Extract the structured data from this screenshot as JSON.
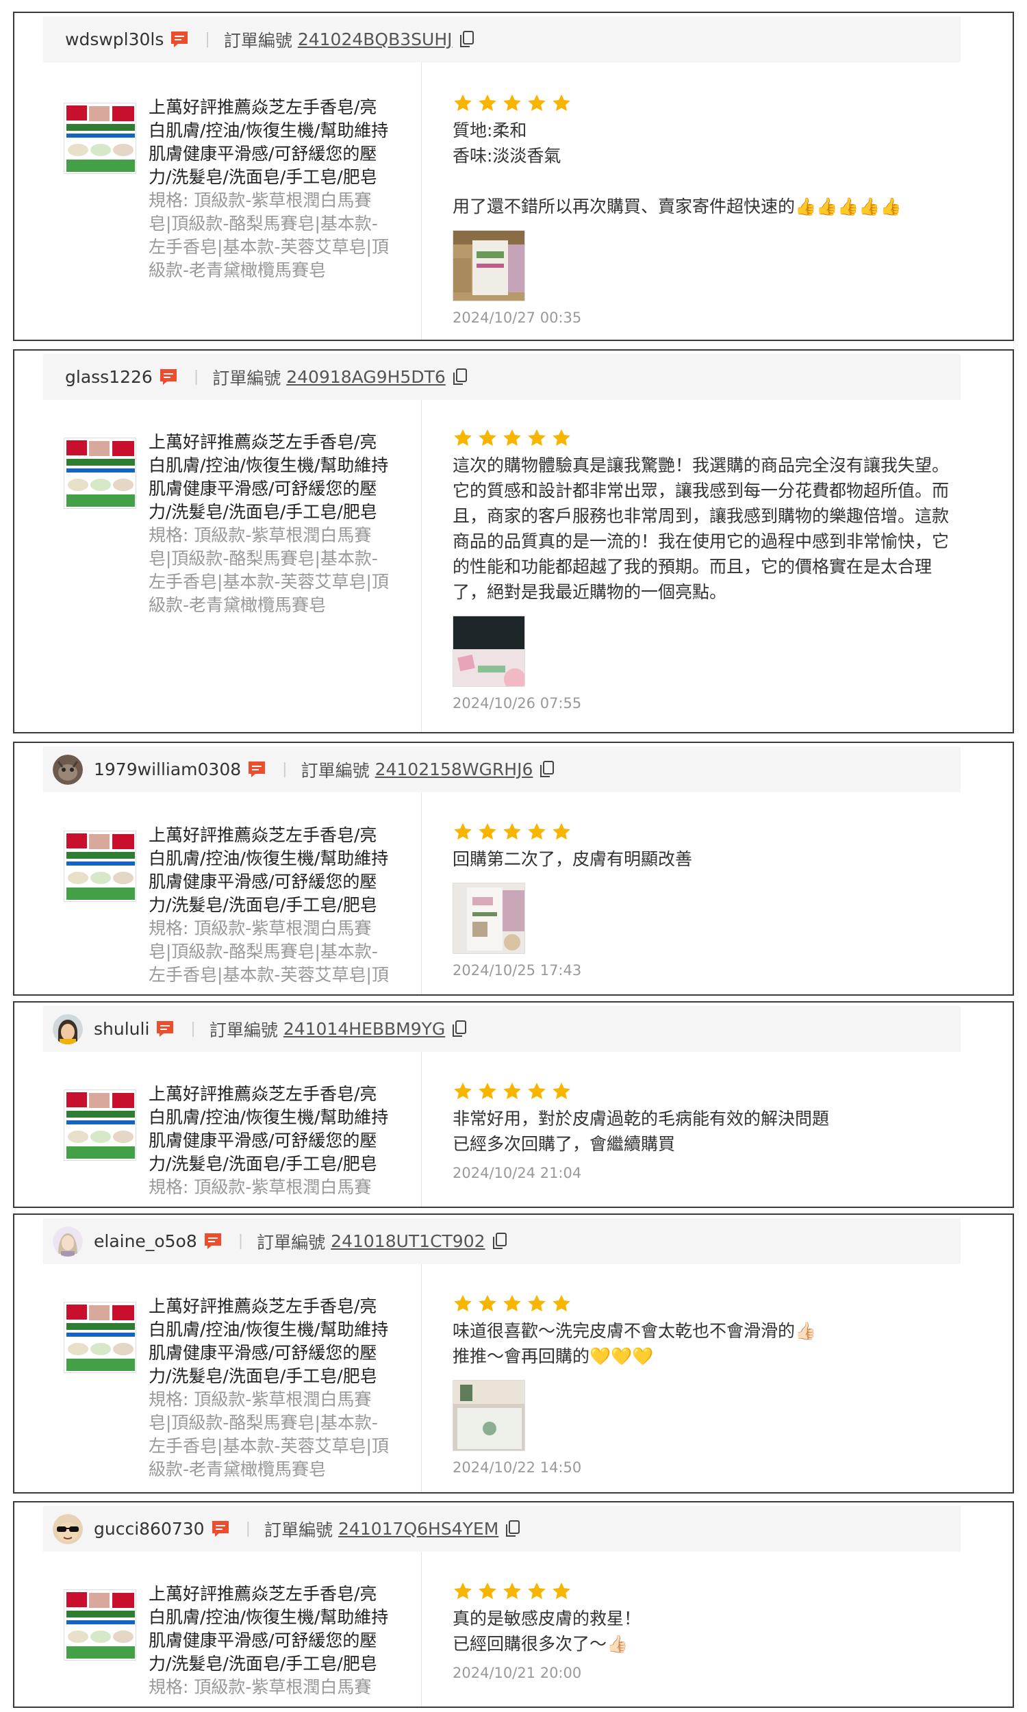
{
  "product": {
    "name": "上萬好評推薦焱芝左手香皂/亮白肌膚/控油/恢復生機/幫助維持肌膚健康平滑感/可舒緩您的壓力/洗髮皂/洗面皂/手工皂/肥皂",
    "spec": "規格: 頂級款-紫草根潤白馬賽皂|頂級款-酪梨馬賽皂|基本款-左手香皂|基本款-芙蓉艾草皂|頂級款-老青黛橄欖馬賽皂"
  },
  "order_label": "訂單編號",
  "colors": {
    "star": "#f7b500",
    "chat": "#ee4d2d",
    "border": "#3a3a3a"
  },
  "icons": {
    "chat": "chat-bubble-icon",
    "copy": "copy-icon",
    "star": "star-icon"
  },
  "reviews": [
    {
      "user": "wdswpl30ls",
      "order": "241024BQB3SUHJ",
      "rating": 5,
      "text": "質地:柔和\n香味:淡淡香氣\n\n用了還不錯所以再次購買、賣家寄件超快速的👍👍👍👍👍",
      "date": "2024/10/27 00:35"
    },
    {
      "user": "glass1226",
      "order": "240918AG9H5DT6",
      "rating": 5,
      "text": "這次的購物體驗真是讓我驚艷！我選購的商品完全沒有讓我失望。它的質感和設計都非常出眾，讓我感到每一分花費都物超所值。而且，商家的客戶服務也非常周到，讓我感到購物的樂趣倍增。這款商品的品質真的是一流的！我在使用它的過程中感到非常愉快，它的性能和功能都超越了我的預期。而且，它的價格實在是太合理了，絕對是我最近購物的一個亮點。",
      "date": "2024/10/26 07:55"
    },
    {
      "user": "1979william0308",
      "order": "24102158WGRHJ6",
      "rating": 5,
      "text": "回購第二次了，皮膚有明顯改善",
      "date": "2024/10/25 17:43"
    },
    {
      "user": "shululi",
      "order": "241014HEBBM9YG",
      "rating": 5,
      "text": "非常好用，對於皮膚過乾的毛病能有效的解決問題\n已經多次回購了，會繼續購買",
      "date": "2024/10/24 21:04"
    },
    {
      "user": "elaine_o5o8",
      "order": "241018UT1CT902",
      "rating": 5,
      "text": "味道很喜歡～洗完皮膚不會太乾也不會滑滑的👍🏻\n推推～會再回購的💛💛💛",
      "date": "2024/10/22 14:50"
    },
    {
      "user": "gucci860730",
      "order": "241017Q6HS4YEM",
      "rating": 5,
      "text": "真的是敏感皮膚的救星！\n已經回購很多次了～👍🏻",
      "date": "2024/10/21 20:00"
    }
  ]
}
